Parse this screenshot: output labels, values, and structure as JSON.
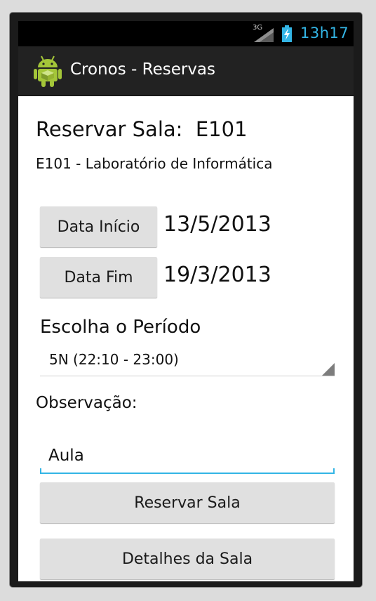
{
  "status_bar": {
    "network": "3G",
    "time": "13h17",
    "icons": [
      "signal-icon",
      "battery-charging-icon"
    ]
  },
  "action_bar": {
    "app_icon": "android-robot-icon",
    "title": "Cronos - Reservas"
  },
  "form": {
    "heading": "Reservar Sala:  E101",
    "room_description": "E101 - Laboratório de Informática",
    "start_date_button": "Data Início",
    "start_date_value": "13/5/2013",
    "end_date_button": "Data Fim",
    "end_date_value": "19/3/2013",
    "period_label": "Escolha o Período",
    "period_selected": "5N (22:10 - 23:00)",
    "observation_label": "Observação:",
    "observation_value": "Aula",
    "reserve_button": "Reservar Sala",
    "details_button": "Detalhes da Sala"
  },
  "colors": {
    "accent": "#33b5e5",
    "action_bar": "#222222",
    "button": "#e0e0e0"
  }
}
